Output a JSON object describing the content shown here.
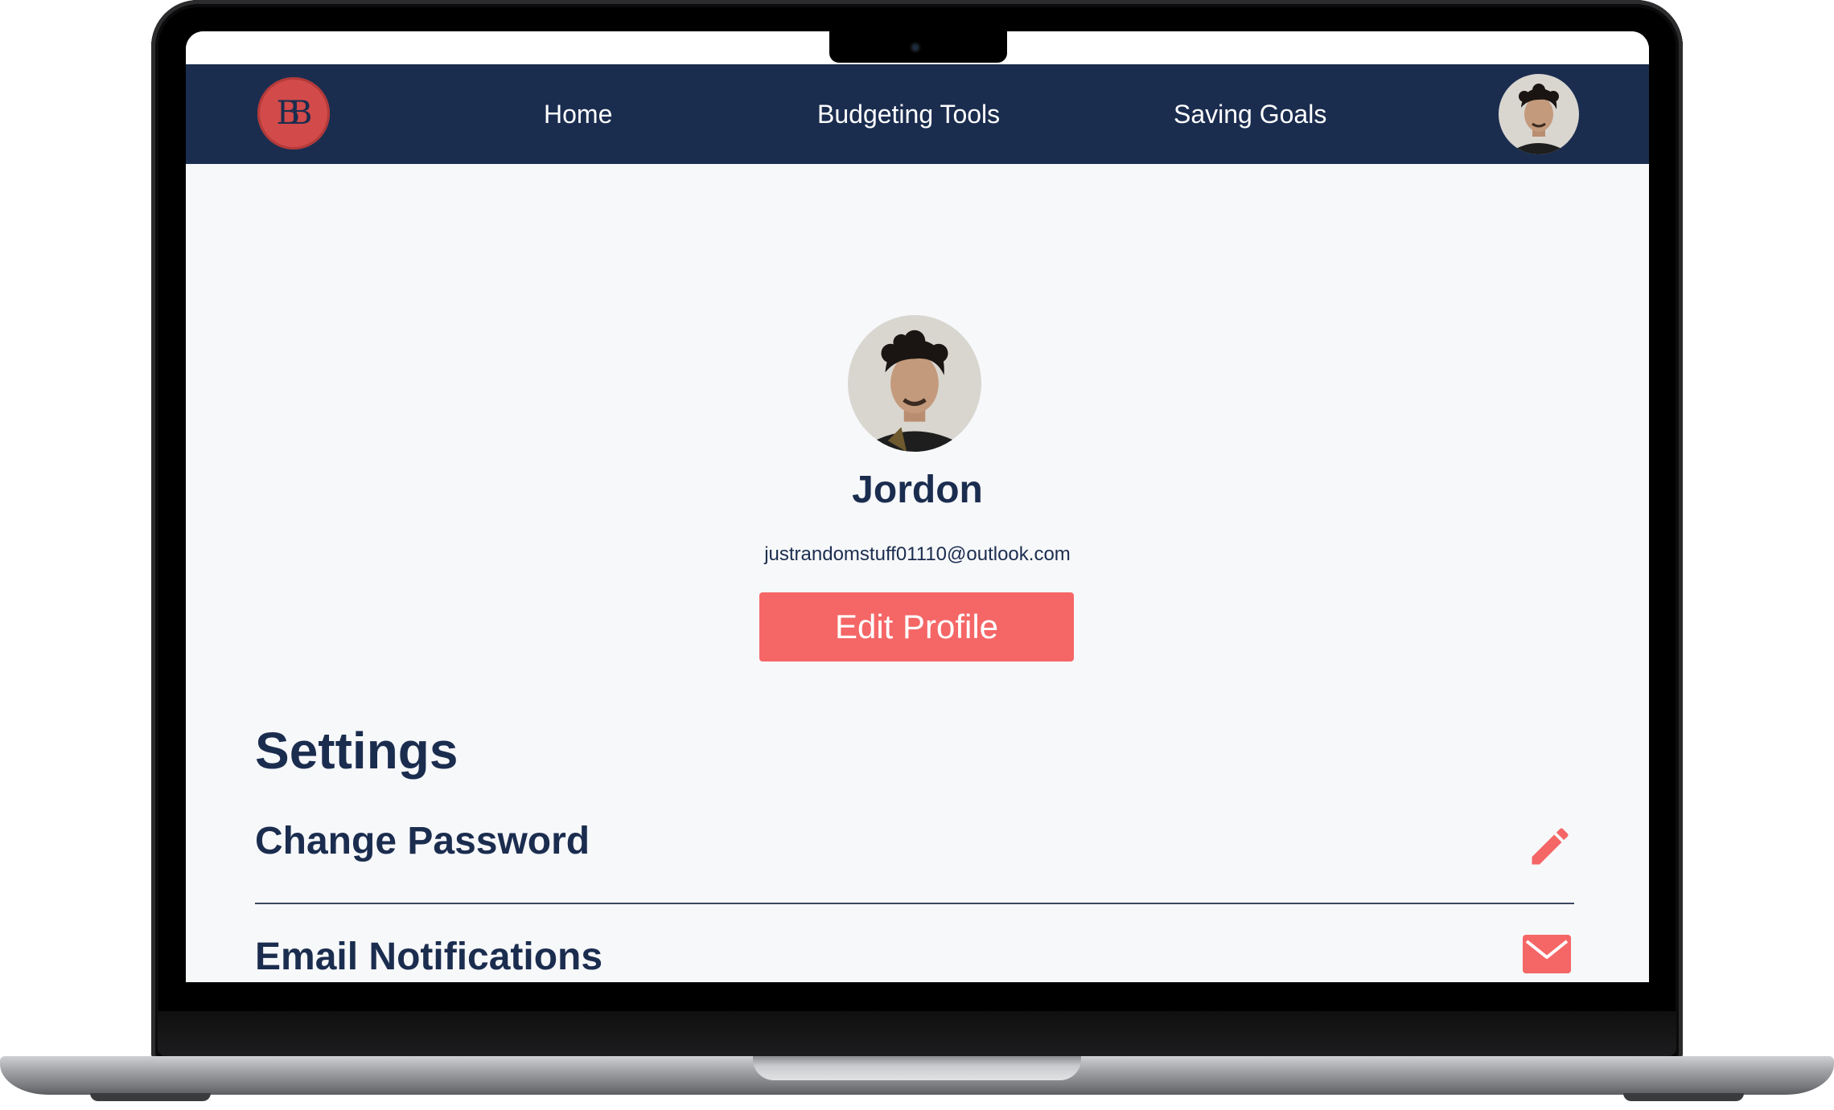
{
  "nav": {
    "logo_text": "BB",
    "links": [
      "Home",
      "Budgeting Tools",
      "Saving Goals"
    ]
  },
  "profile": {
    "name": "Jordon",
    "email": "justrandomstuff01110@outlook.com",
    "edit_label": "Edit Profile"
  },
  "settings": {
    "title": "Settings",
    "items": [
      {
        "label": "Change Password",
        "icon": "pencil-icon"
      },
      {
        "label": "Email Notifications",
        "icon": "envelope-icon"
      }
    ]
  },
  "colors": {
    "nav_bg": "#1b2d4f",
    "accent": "#f56666",
    "text": "#1b2d4f",
    "page_bg": "#f7f8fa"
  }
}
